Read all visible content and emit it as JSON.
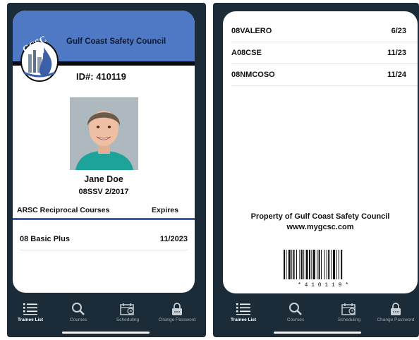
{
  "card_front": {
    "org_name": "Gulf Coast Safety Council",
    "logo_text": "GCSC",
    "id_label": "ID#:",
    "id_number": "410119",
    "trainee_name": "Jane Doe",
    "certification": "08SSV",
    "certification_date": "2/2017",
    "courses_header": "ARSC Reciprocal Courses",
    "expires_header": "Expires",
    "courses": [
      {
        "name": "08 Basic Plus",
        "expires": "11/2023"
      }
    ]
  },
  "card_back": {
    "courses": [
      {
        "name": "08VALERO",
        "expires": "6/23"
      },
      {
        "name": "A08CSE",
        "expires": "11/23"
      },
      {
        "name": "08NMCOSO",
        "expires": "11/24"
      }
    ],
    "property_line": "Property of Gulf Coast Safety Council",
    "website": "www.mygcsc.com",
    "barcode_text": "* 4 1 0 1 1 9 *"
  },
  "tabbar": {
    "trainee_list": "Trainee List",
    "courses": "Courses",
    "scheduling": "Scheduling",
    "change_password": "Change Password",
    "active_tab": "trainee_list"
  },
  "colors": {
    "header_blue": "#4f79c4",
    "phone_bg": "#1b2c38",
    "accent_rule": "#3b5ea8"
  }
}
